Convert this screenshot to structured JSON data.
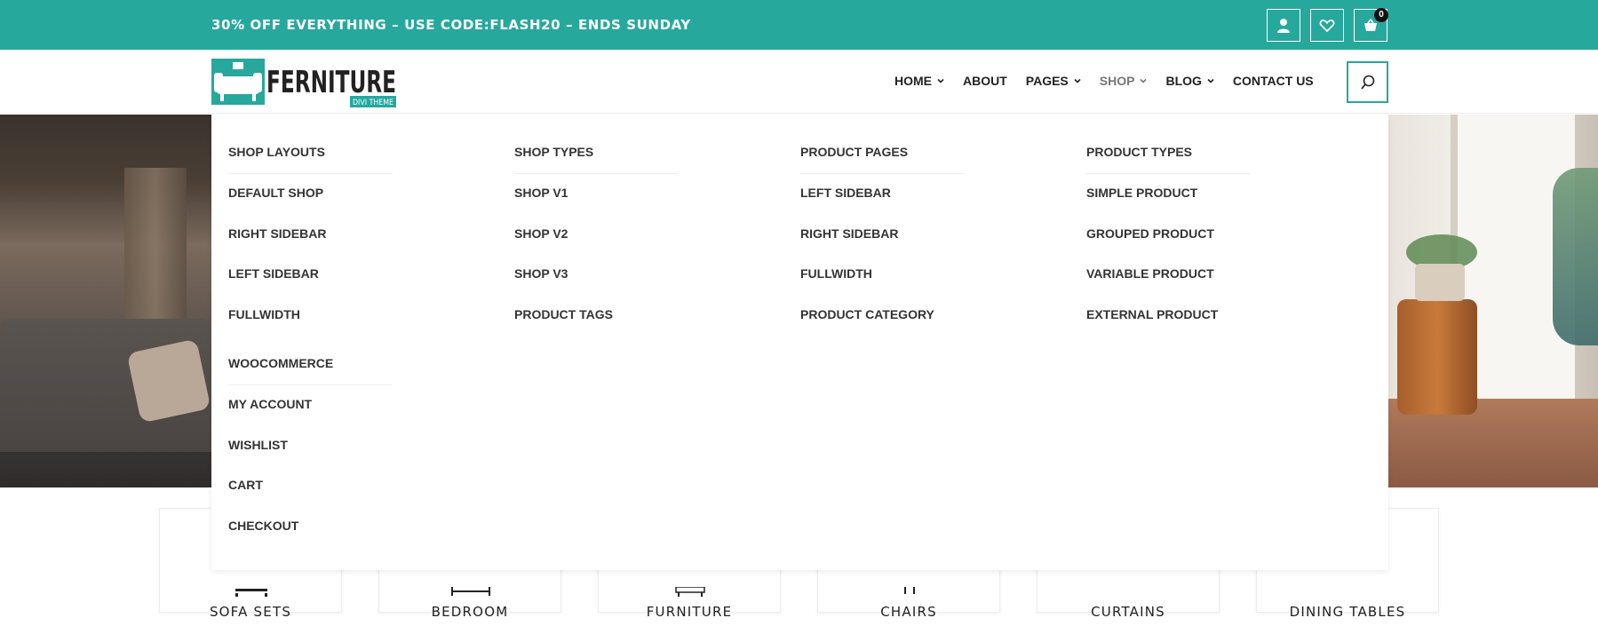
{
  "topbar": {
    "promo": "30% OFF EVERYTHING – USE CODE:FLASH20 – ENDS SUNDAY",
    "icons": [
      "user-icon",
      "heart-icon",
      "cart-icon"
    ],
    "cart_count": "0",
    "bg_color": "#26a89d"
  },
  "header": {
    "logo": {
      "word": "FERNITURE",
      "tag": "DIVI THEME"
    },
    "nav": [
      {
        "label": "HOME",
        "has_dropdown": true,
        "active": false
      },
      {
        "label": "ABOUT",
        "has_dropdown": false,
        "active": false
      },
      {
        "label": "PAGES",
        "has_dropdown": true,
        "active": false
      },
      {
        "label": "SHOP",
        "has_dropdown": true,
        "active": true
      },
      {
        "label": "BLOG",
        "has_dropdown": true,
        "active": false
      },
      {
        "label": "CONTACT US",
        "has_dropdown": false,
        "active": false
      }
    ],
    "search_icon": "search-icon",
    "accent": "#26a89d"
  },
  "mega_menu": {
    "columns": [
      {
        "heading": "SHOP LAYOUTS",
        "links": [
          "DEFAULT SHOP",
          "RIGHT SIDEBAR",
          "LEFT SIDEBAR",
          "FULLWIDTH"
        ],
        "heading2": "WOOCOMMERCE",
        "links2": [
          "MY ACCOUNT",
          "WISHLIST",
          "CART",
          "CHECKOUT"
        ]
      },
      {
        "heading": "SHOP TYPES",
        "links": [
          "SHOP V1",
          "SHOP V2",
          "SHOP V3",
          "PRODUCT TAGS"
        ]
      },
      {
        "heading": "PRODUCT PAGES",
        "links": [
          "LEFT SIDEBAR",
          "RIGHT SIDEBAR",
          "FULLWIDTH",
          "PRODUCT CATEGORY"
        ]
      },
      {
        "heading": "PRODUCT TYPES",
        "links": [
          "SIMPLE PRODUCT",
          "GROUPED PRODUCT",
          "VARIABLE PRODUCT",
          "EXTERNAL PRODUCT"
        ]
      }
    ]
  },
  "categories": [
    "SOFA SETS",
    "BEDROOM",
    "FURNITURE",
    "CHAIRS",
    "CURTAINS",
    "DINING TABLES"
  ]
}
